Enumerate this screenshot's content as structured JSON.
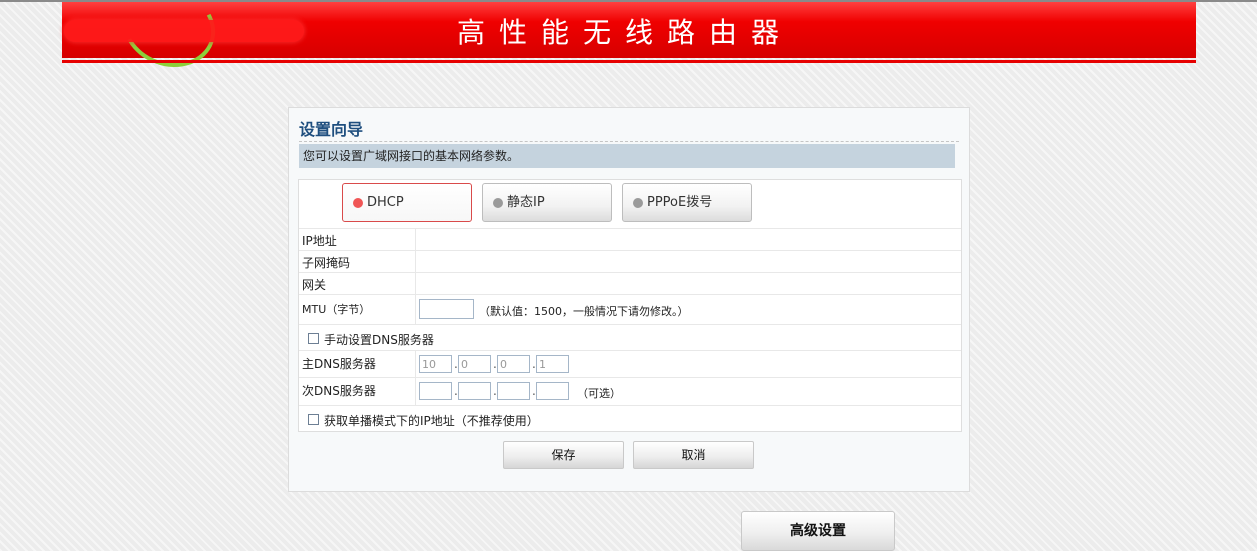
{
  "header": {
    "title": "高性能无线路由器"
  },
  "wizard": {
    "title": "设置向导",
    "description": "您可以设置广域网接口的基本网络参数。",
    "tabs": [
      {
        "label": "DHCP",
        "active": true
      },
      {
        "label": "静态IP",
        "active": false
      },
      {
        "label": "PPPoE拨号",
        "active": false
      }
    ],
    "fields": {
      "ip_label": "IP地址",
      "mask_label": "子网掩码",
      "gateway_label": "网关",
      "mtu_label": "MTU（字节）",
      "mtu_value": "",
      "mtu_note": "（默认值：1500，一般情况下请勿修改。）",
      "manual_dns_label": "手动设置DNS服务器",
      "manual_dns_checked": false,
      "primary_dns_label": "主DNS服务器",
      "primary_dns": [
        "10",
        "0",
        "0",
        "1"
      ],
      "secondary_dns_label": "次DNS服务器",
      "secondary_dns": [
        "",
        "",
        "",
        ""
      ],
      "secondary_dns_note": "（可选）",
      "unicast_label": "获取单播模式下的IP地址（不推荐使用）",
      "unicast_checked": false
    },
    "buttons": {
      "save": "保存",
      "cancel": "取消"
    }
  },
  "advanced_button": "高级设置",
  "colors": {
    "header_red": "#e60000",
    "title_blue": "#1f4f7f",
    "desc_bar": "#c5d3de",
    "active_dot": "#f05656"
  }
}
